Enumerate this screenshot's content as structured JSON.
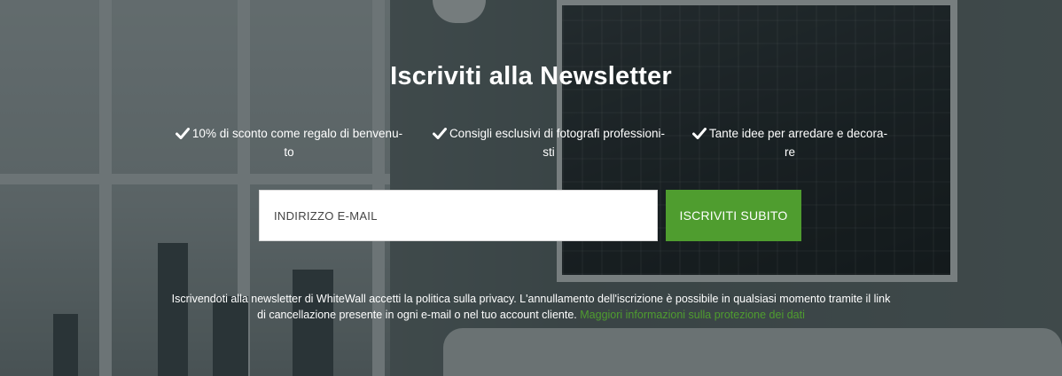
{
  "newsletter": {
    "title": "Iscriviti alla Newsletter",
    "benefits": [
      {
        "icon": "checkmark-icon",
        "line1": "10% di sconto come regalo di benvenu-",
        "line2": "to"
      },
      {
        "icon": "checkmark-icon",
        "line1": "Consigli esclusivi di fotografi professioni-",
        "line2": "sti"
      },
      {
        "icon": "checkmark-icon",
        "line1": "Tante idee per arredare e decora-",
        "line2": "re"
      }
    ],
    "email_placeholder": "INDIRIZZO E-MAIL",
    "email_value": "",
    "subscribe_label": "ISCRIVITI SUBITO",
    "legal_text": "Iscrivendoti alla newsletter di WhiteWall accetti la politica sulla privacy. L'annullamento dell'iscrizione è possibile in qualsiasi momento tramite il link di cancellazione presente in ogni e-mail o nel tuo account cliente. ",
    "legal_link": "Maggiori informazioni sulla protezione dei dati"
  },
  "colors": {
    "accent_green": "#4f9d2f",
    "text_white": "#ffffff",
    "overlay": "rgba(28,36,38,0.55)"
  }
}
